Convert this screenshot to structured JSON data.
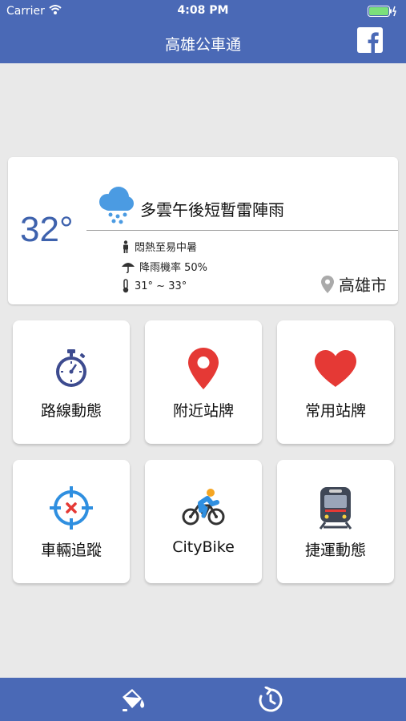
{
  "status": {
    "carrier": "Carrier",
    "time": "4:08 PM"
  },
  "nav": {
    "title": "高雄公車通",
    "facebook_icon": "facebook-icon"
  },
  "weather": {
    "temperature": "32°",
    "description": "多雲午後短暫雷陣雨",
    "comfort": "悶熱至易中暑",
    "rain_chance": "降雨機率 50%",
    "temp_range": "31° ~ 33°",
    "city": "高雄市"
  },
  "menu": {
    "route": "路線動態",
    "nearby": "附近站牌",
    "favorite": "常用站牌",
    "tracking": "車輛追蹤",
    "citybike": "CityBike",
    "metro": "捷運動態"
  },
  "colors": {
    "primary": "#4a69b6",
    "accent_red": "#e53935",
    "icon_blue": "#2f8fe0"
  }
}
